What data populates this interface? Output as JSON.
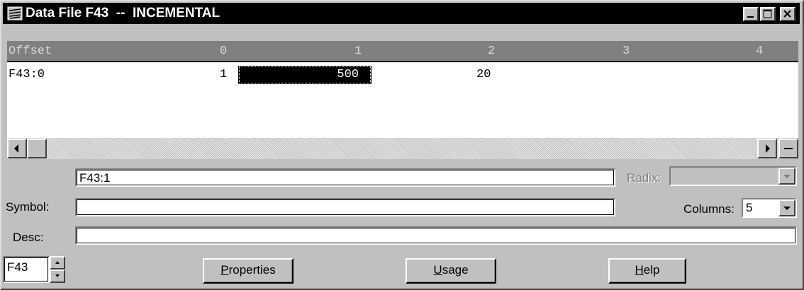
{
  "window": {
    "title": "Data File F43  --  INCEMENTAL"
  },
  "grid": {
    "headers": [
      "Offset",
      "0",
      "1",
      "2",
      "3",
      "4"
    ],
    "rows": [
      {
        "offset": "F43:0",
        "values": [
          "1",
          "500",
          "20",
          "",
          ""
        ]
      }
    ],
    "selected_value": "500"
  },
  "address_field": {
    "value": "F43:1"
  },
  "radix": {
    "label": "Radix:",
    "value": ""
  },
  "symbol": {
    "label": "Symbol:",
    "value": ""
  },
  "columns": {
    "label": "Columns:",
    "value": "5"
  },
  "desc": {
    "label": "Desc:",
    "value": ""
  },
  "file_spinner": {
    "value": "F43"
  },
  "buttons": {
    "properties_rest": "roperties",
    "properties_key": "P",
    "usage_key": "U",
    "usage_rest": "sage",
    "help_key": "H",
    "help_rest": "elp"
  }
}
